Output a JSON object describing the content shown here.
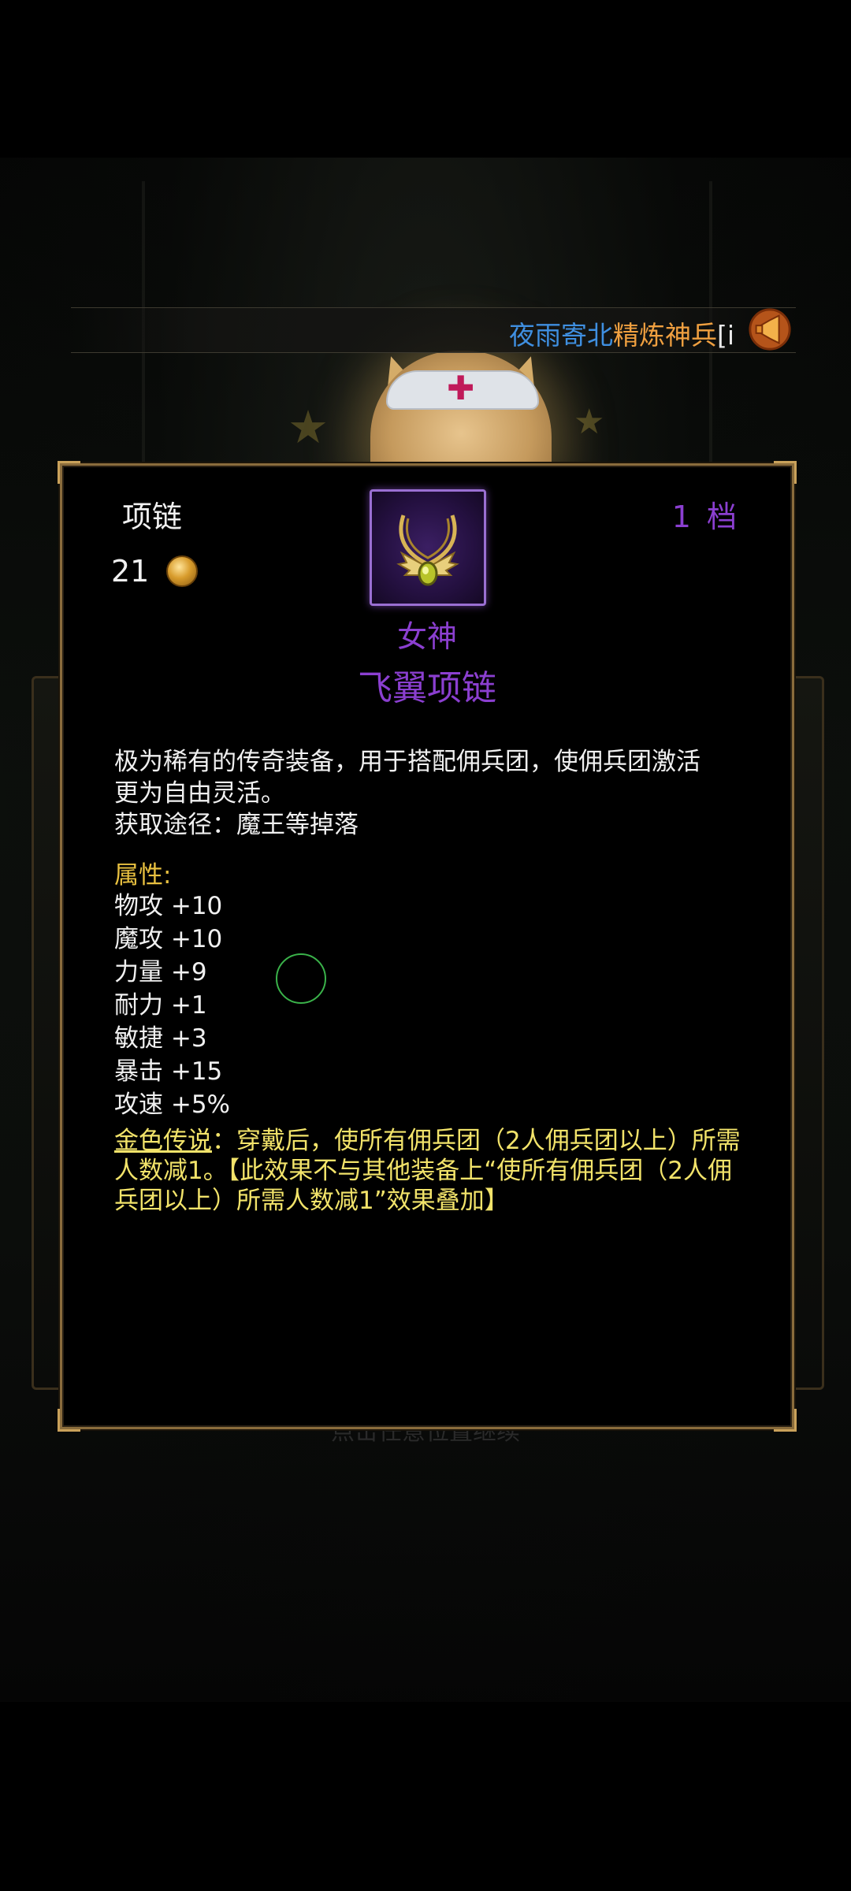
{
  "notice": {
    "player_name": "夜雨寄北",
    "message": "精炼神兵",
    "bracket": "[i",
    "icon": "megaphone-icon"
  },
  "item": {
    "type": "项链",
    "price": "21",
    "price_icon": "gold-coin-icon",
    "tier_number": "1",
    "tier_unit": "档",
    "icon": "winged-necklace-icon",
    "name_line1": "女神",
    "name_line2": "飞翼项链",
    "description_line1": "极为稀有的传奇装备，用于搭配佣兵团，使佣兵团激活",
    "description_line2": "更为自由灵活。",
    "source": "获取途径：魔王等掉落",
    "attributes_title": "属性:",
    "attributes": [
      "物攻 +10",
      "魔攻 +10",
      "力量 +9",
      "耐力 +1",
      "敏捷 +3",
      "暴击 +15",
      "攻速 +5%"
    ],
    "legend_label": "金色传说",
    "legend_text": "：穿戴后，使所有佣兵团（2人佣兵团以上）所需人数减1。【此效果不与其他装备上“使所有佣兵团（2人佣兵团以上）所需人数减1”效果叠加】"
  },
  "footer": {
    "continue_hint": "点击任意位置继续"
  },
  "colors": {
    "rarity_purple": "#8b3fd0",
    "attribute_gold": "#e8c040",
    "legend_yellow": "#f2e36a",
    "frame_gold": "#8a6c3c"
  }
}
